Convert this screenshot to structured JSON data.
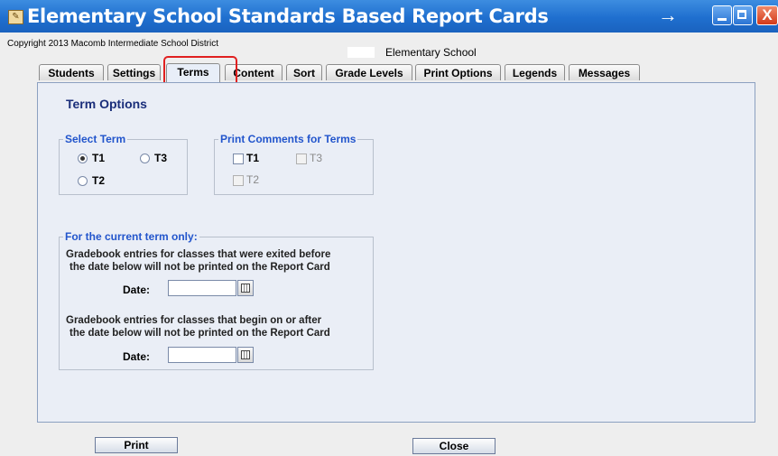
{
  "window": {
    "title": "Elementary School Standards Based Report Cards",
    "arrow_icon": "right-arrow-icon",
    "close_glyph": "X"
  },
  "header": {
    "copyright": "Copyright 2013 Macomb Intermediate School District",
    "school_name": "Elementary School"
  },
  "tabs": [
    {
      "label": "Students"
    },
    {
      "label": "Settings"
    },
    {
      "label": "Terms",
      "active": true
    },
    {
      "label": "Content"
    },
    {
      "label": "Sort"
    },
    {
      "label": "Grade Levels"
    },
    {
      "label": "Print Options"
    },
    {
      "label": "Legends"
    },
    {
      "label": "Messages"
    }
  ],
  "term_options": {
    "title": "Term Options",
    "select_term": {
      "legend": "Select Term",
      "options": [
        {
          "label": "T1",
          "checked": true
        },
        {
          "label": "T3",
          "checked": false
        },
        {
          "label": "T2",
          "checked": false
        }
      ]
    },
    "print_comments": {
      "legend": "Print Comments for Terms",
      "options": [
        {
          "label": "T1",
          "enabled": true,
          "checked": false
        },
        {
          "label": "T3",
          "enabled": false,
          "checked": false
        },
        {
          "label": "T2",
          "enabled": false,
          "checked": false
        }
      ]
    },
    "current_term": {
      "legend": "For the current term only:",
      "exited_text_1": "Gradebook entries for classes that were exited before",
      "exited_text_2": "the date below will not be printed on the Report Card",
      "begin_text_1": "Gradebook entries for classes that begin on or after",
      "begin_text_2": "the date below will not be printed on the Report Card",
      "date_label": "Date:",
      "exited_date": "",
      "begin_date": ""
    }
  },
  "buttons": {
    "print": "Print",
    "close": "Close"
  }
}
